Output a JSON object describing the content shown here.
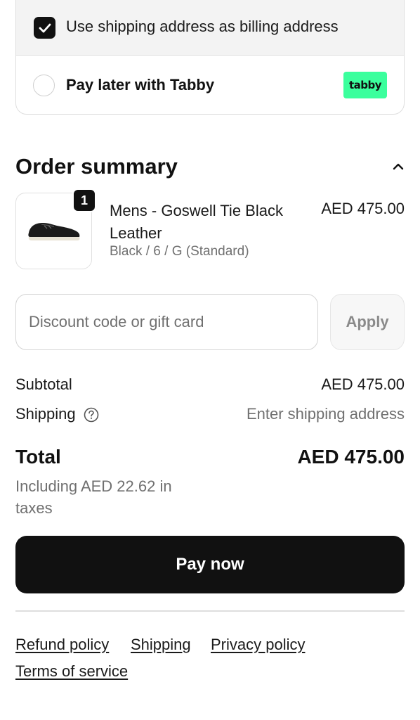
{
  "payment": {
    "billing_same_label": "Use shipping address as billing address",
    "billing_same_checked": true,
    "tabby_label": "Pay later with Tabby",
    "tabby_logo": "tabby",
    "tabby_brand_color": "#3bff9d"
  },
  "order_summary": {
    "title": "Order summary",
    "collapse_icon": "chevron-up-icon",
    "item": {
      "quantity": "1",
      "name": "Mens - Goswell Tie Black Leather",
      "variant": "Black / 6 / G (Standard)",
      "price": "AED 475.00"
    },
    "discount": {
      "placeholder": "Discount code or gift card",
      "apply_label": "Apply"
    },
    "subtotal_label": "Subtotal",
    "subtotal_value": "AED 475.00",
    "shipping_label": "Shipping",
    "shipping_value": "Enter shipping address",
    "total_label": "Total",
    "total_value": "AED 475.00",
    "tax_note": "Including AED 22.62 in taxes"
  },
  "pay_now_label": "Pay now",
  "footer": {
    "links": [
      "Refund policy",
      "Shipping",
      "Privacy policy",
      "Terms of service"
    ]
  },
  "colors": {
    "primary": "#111111",
    "muted_text": "#707070",
    "border": "#dedede"
  }
}
